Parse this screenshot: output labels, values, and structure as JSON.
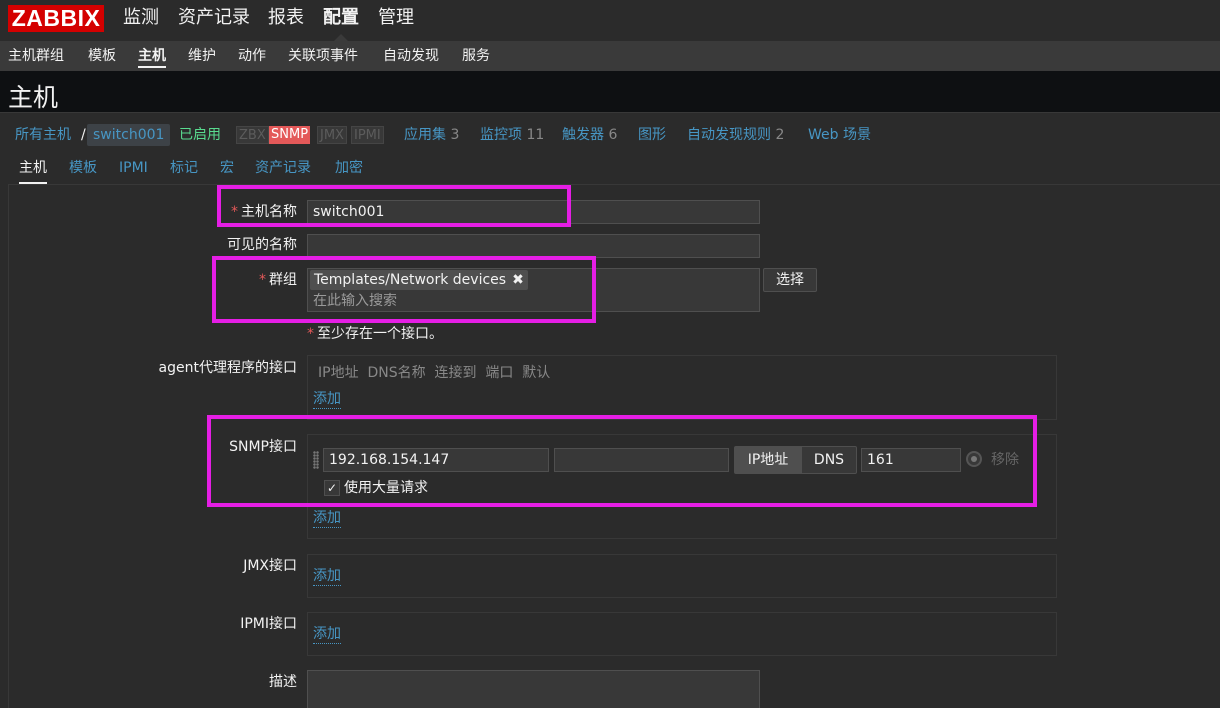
{
  "brand": "ZABBIX",
  "nav": {
    "main": [
      "监测",
      "资产记录",
      "报表",
      "配置",
      "管理"
    ],
    "sub": [
      "主机群组",
      "模板",
      "主机",
      "维护",
      "动作",
      "关联项事件",
      "自动发现",
      "服务"
    ]
  },
  "page_title": "主机",
  "breadcrumb": {
    "all_hosts": "所有主机",
    "separator": "/",
    "current": "switch001",
    "status": "已启用",
    "availability": [
      "ZBX",
      "SNMP",
      "JMX",
      "IPMI"
    ],
    "links": [
      {
        "label": "应用集",
        "count": "3"
      },
      {
        "label": "监控项",
        "count": "11"
      },
      {
        "label": "触发器",
        "count": "6"
      },
      {
        "label": "图形",
        "count": ""
      },
      {
        "label": "自动发现规则",
        "count": "2"
      },
      {
        "label": "Web 场景",
        "count": ""
      }
    ]
  },
  "tabs": [
    "主机",
    "模板",
    "IPMI",
    "标记",
    "宏",
    "资产记录",
    "加密"
  ],
  "form": {
    "required_mark": "*",
    "host_name_label": "主机名称",
    "host_name_value": "switch001",
    "visible_name_label": "可见的名称",
    "visible_name_value": "",
    "groups_label": "群组",
    "group_tag": "Templates/Network devices",
    "group_tag_remove": "✖",
    "groups_placeholder": "在此输入搜索",
    "select_button": "选择",
    "interface_warning": "至少存在一个接口。",
    "agent_label": "agent代理程序的接口",
    "interface_headers": "IP地址  DNS名称  连接到  端口  默认",
    "add_link": "添加",
    "snmp_label": "SNMP接口",
    "snmp_ip": "192.168.154.147",
    "snmp_dns": "",
    "connect_ip": "IP地址",
    "connect_dns": "DNS",
    "snmp_port": "161",
    "remove_link": "移除",
    "bulk_label": "使用大量请求",
    "bulk_checked": "✓",
    "jmx_label": "JMX接口",
    "ipmi_label": "IPMI接口",
    "description_label": "描述"
  }
}
